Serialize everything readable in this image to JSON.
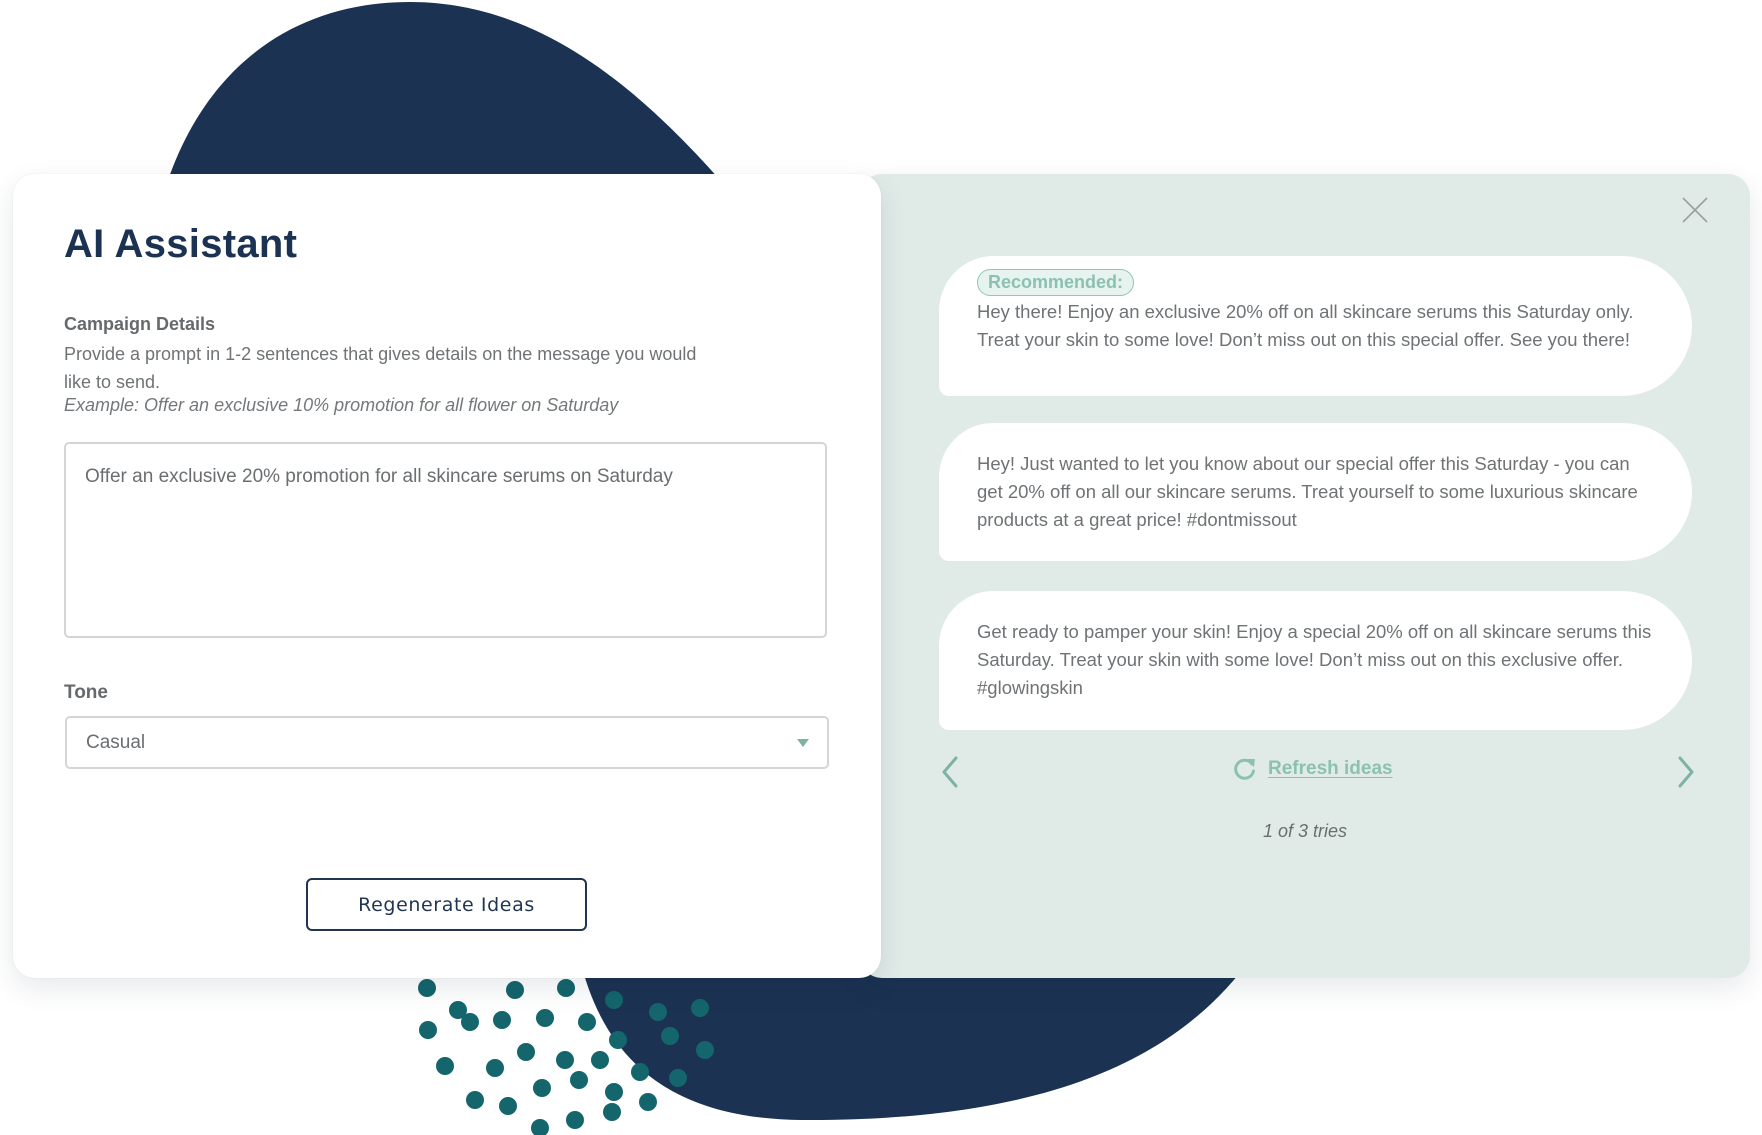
{
  "decoration": {
    "blob_color": "#1b3252",
    "dots_color": "#14656c"
  },
  "left_panel": {
    "title": "AI Assistant",
    "campaign_label": "Campaign Details",
    "campaign_description": "Provide a prompt in 1-2 sentences that gives details on the message you would like to send.",
    "example": "Example:  Offer an exclusive 10% promotion for all flower on Saturday",
    "prompt_value": "Offer an exclusive 20% promotion for all skincare serums on Saturday",
    "tone_label": "Tone",
    "tone_selected": "Casual",
    "regenerate_label": "Regenerate Ideas"
  },
  "right_panel": {
    "background": "#e0ebe8",
    "accent": "#8cc1b2",
    "recommended_badge": "Recommended:",
    "suggestions": [
      {
        "recommended": true,
        "text": "Hey there! Enjoy an exclusive 20% off on all skincare serums this Saturday only. Treat your skin to some love! Don’t miss out on this special offer. See you there!"
      },
      {
        "recommended": false,
        "text": "Hey! Just wanted to let you know about our special offer this Saturday - you can get 20% off on all our skincare serums. Treat yourself to some luxurious skincare products at a great price! #dontmissout"
      },
      {
        "recommended": false,
        "text": "Get ready to pamper your skin! Enjoy a special 20% off on all skincare serums this Saturday. Treat your skin with some love! Don’t miss out on this exclusive offer. #glowingskin"
      }
    ],
    "refresh_label": "Refresh ideas",
    "tries_text": "1 of 3 tries",
    "tries_current": 1,
    "tries_total": 3
  }
}
